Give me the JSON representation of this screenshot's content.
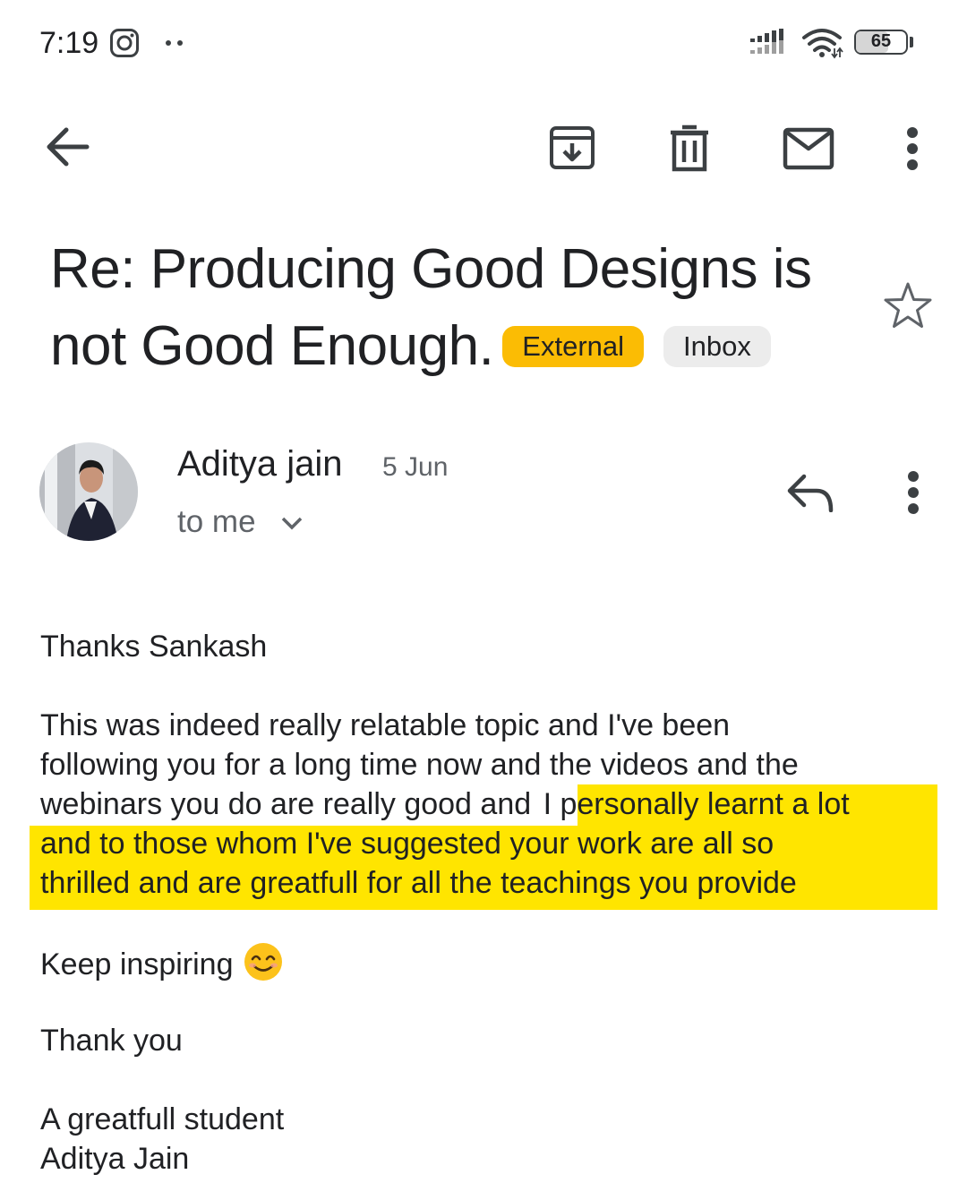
{
  "status_bar": {
    "time": "7:19",
    "battery": "65",
    "battery_level": 0.65
  },
  "toolbar": {
    "back": "back-arrow-icon",
    "archive": "archive-icon",
    "delete": "trash-icon",
    "mark_unread": "mail-icon",
    "more": "more-vert-icon"
  },
  "email": {
    "subject_line1": "Re: Producing Good Designs is",
    "subject_line2": "not Good Enough.",
    "labels": [
      "External",
      "Inbox"
    ],
    "label_colors": {
      "external": "#fbbc04",
      "inbox": "#ececec"
    },
    "starred": false
  },
  "sender": {
    "name": "Aditya jain",
    "date": "5 Jun",
    "recipient": "to me"
  },
  "body": {
    "greeting": "Thanks Sankash",
    "para1_line1": "This was indeed really relatable topic and I've been",
    "para1_line2": "following you for a long time now and the videos and the",
    "para1_line3_plain": "webinars you do are really good and ",
    "para1_line3_highlight": "I personally learnt a lot",
    "para1_line4": "and to those whom I've suggested your work are all so",
    "para1_line5": "thrilled and are greatfull for all the teachings you provide",
    "keep": "Keep inspiring",
    "emoji": "smiling-face-emoji",
    "thanks": "Thank you",
    "sign1": "A greatfull student",
    "sign2": "Aditya Jain",
    "highlight_color": "#ffe500"
  }
}
